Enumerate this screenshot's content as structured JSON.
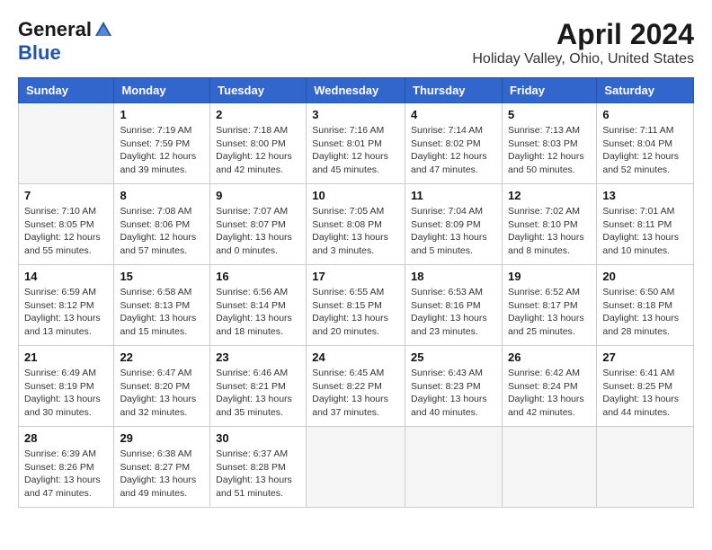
{
  "logo": {
    "general": "General",
    "blue": "Blue"
  },
  "title": "April 2024",
  "subtitle": "Holiday Valley, Ohio, United States",
  "days_of_week": [
    "Sunday",
    "Monday",
    "Tuesday",
    "Wednesday",
    "Thursday",
    "Friday",
    "Saturday"
  ],
  "weeks": [
    [
      {
        "day": "",
        "info": ""
      },
      {
        "day": "1",
        "info": "Sunrise: 7:19 AM\nSunset: 7:59 PM\nDaylight: 12 hours\nand 39 minutes."
      },
      {
        "day": "2",
        "info": "Sunrise: 7:18 AM\nSunset: 8:00 PM\nDaylight: 12 hours\nand 42 minutes."
      },
      {
        "day": "3",
        "info": "Sunrise: 7:16 AM\nSunset: 8:01 PM\nDaylight: 12 hours\nand 45 minutes."
      },
      {
        "day": "4",
        "info": "Sunrise: 7:14 AM\nSunset: 8:02 PM\nDaylight: 12 hours\nand 47 minutes."
      },
      {
        "day": "5",
        "info": "Sunrise: 7:13 AM\nSunset: 8:03 PM\nDaylight: 12 hours\nand 50 minutes."
      },
      {
        "day": "6",
        "info": "Sunrise: 7:11 AM\nSunset: 8:04 PM\nDaylight: 12 hours\nand 52 minutes."
      }
    ],
    [
      {
        "day": "7",
        "info": "Sunrise: 7:10 AM\nSunset: 8:05 PM\nDaylight: 12 hours\nand 55 minutes."
      },
      {
        "day": "8",
        "info": "Sunrise: 7:08 AM\nSunset: 8:06 PM\nDaylight: 12 hours\nand 57 minutes."
      },
      {
        "day": "9",
        "info": "Sunrise: 7:07 AM\nSunset: 8:07 PM\nDaylight: 13 hours\nand 0 minutes."
      },
      {
        "day": "10",
        "info": "Sunrise: 7:05 AM\nSunset: 8:08 PM\nDaylight: 13 hours\nand 3 minutes."
      },
      {
        "day": "11",
        "info": "Sunrise: 7:04 AM\nSunset: 8:09 PM\nDaylight: 13 hours\nand 5 minutes."
      },
      {
        "day": "12",
        "info": "Sunrise: 7:02 AM\nSunset: 8:10 PM\nDaylight: 13 hours\nand 8 minutes."
      },
      {
        "day": "13",
        "info": "Sunrise: 7:01 AM\nSunset: 8:11 PM\nDaylight: 13 hours\nand 10 minutes."
      }
    ],
    [
      {
        "day": "14",
        "info": "Sunrise: 6:59 AM\nSunset: 8:12 PM\nDaylight: 13 hours\nand 13 minutes."
      },
      {
        "day": "15",
        "info": "Sunrise: 6:58 AM\nSunset: 8:13 PM\nDaylight: 13 hours\nand 15 minutes."
      },
      {
        "day": "16",
        "info": "Sunrise: 6:56 AM\nSunset: 8:14 PM\nDaylight: 13 hours\nand 18 minutes."
      },
      {
        "day": "17",
        "info": "Sunrise: 6:55 AM\nSunset: 8:15 PM\nDaylight: 13 hours\nand 20 minutes."
      },
      {
        "day": "18",
        "info": "Sunrise: 6:53 AM\nSunset: 8:16 PM\nDaylight: 13 hours\nand 23 minutes."
      },
      {
        "day": "19",
        "info": "Sunrise: 6:52 AM\nSunset: 8:17 PM\nDaylight: 13 hours\nand 25 minutes."
      },
      {
        "day": "20",
        "info": "Sunrise: 6:50 AM\nSunset: 8:18 PM\nDaylight: 13 hours\nand 28 minutes."
      }
    ],
    [
      {
        "day": "21",
        "info": "Sunrise: 6:49 AM\nSunset: 8:19 PM\nDaylight: 13 hours\nand 30 minutes."
      },
      {
        "day": "22",
        "info": "Sunrise: 6:47 AM\nSunset: 8:20 PM\nDaylight: 13 hours\nand 32 minutes."
      },
      {
        "day": "23",
        "info": "Sunrise: 6:46 AM\nSunset: 8:21 PM\nDaylight: 13 hours\nand 35 minutes."
      },
      {
        "day": "24",
        "info": "Sunrise: 6:45 AM\nSunset: 8:22 PM\nDaylight: 13 hours\nand 37 minutes."
      },
      {
        "day": "25",
        "info": "Sunrise: 6:43 AM\nSunset: 8:23 PM\nDaylight: 13 hours\nand 40 minutes."
      },
      {
        "day": "26",
        "info": "Sunrise: 6:42 AM\nSunset: 8:24 PM\nDaylight: 13 hours\nand 42 minutes."
      },
      {
        "day": "27",
        "info": "Sunrise: 6:41 AM\nSunset: 8:25 PM\nDaylight: 13 hours\nand 44 minutes."
      }
    ],
    [
      {
        "day": "28",
        "info": "Sunrise: 6:39 AM\nSunset: 8:26 PM\nDaylight: 13 hours\nand 47 minutes."
      },
      {
        "day": "29",
        "info": "Sunrise: 6:38 AM\nSunset: 8:27 PM\nDaylight: 13 hours\nand 49 minutes."
      },
      {
        "day": "30",
        "info": "Sunrise: 6:37 AM\nSunset: 8:28 PM\nDaylight: 13 hours\nand 51 minutes."
      },
      {
        "day": "",
        "info": ""
      },
      {
        "day": "",
        "info": ""
      },
      {
        "day": "",
        "info": ""
      },
      {
        "day": "",
        "info": ""
      }
    ]
  ]
}
